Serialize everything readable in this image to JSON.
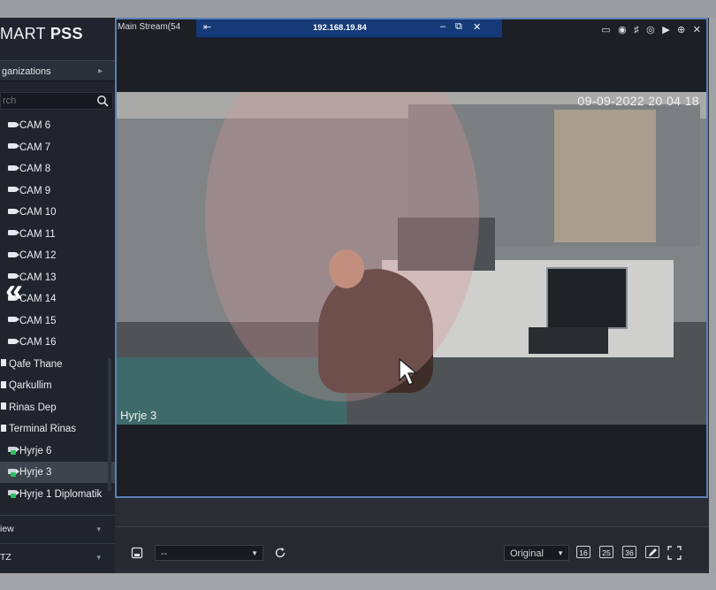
{
  "app": {
    "brand_light": "MART",
    "brand_bold": "PSS"
  },
  "sidebar": {
    "org_label": "ganizations",
    "search_placeholder": "rch",
    "items": [
      {
        "label": "CAM 6",
        "type": "camera"
      },
      {
        "label": "CAM 7",
        "type": "camera"
      },
      {
        "label": "CAM 8",
        "type": "camera"
      },
      {
        "label": "CAM 9",
        "type": "camera"
      },
      {
        "label": "CAM 10",
        "type": "camera"
      },
      {
        "label": "CAM 11",
        "type": "camera"
      },
      {
        "label": "CAM 12",
        "type": "camera"
      },
      {
        "label": "CAM 13",
        "type": "camera"
      },
      {
        "label": "CAM 14",
        "type": "camera"
      },
      {
        "label": "CAM 15",
        "type": "camera"
      },
      {
        "label": "CAM 16",
        "type": "camera"
      },
      {
        "label": "Qafe Thane",
        "type": "device"
      },
      {
        "label": "Qarkullim",
        "type": "device"
      },
      {
        "label": "Rinas Dep",
        "type": "device"
      },
      {
        "label": "Terminal Rinas",
        "type": "device"
      },
      {
        "label": "Hyrje 6",
        "type": "camera-online"
      },
      {
        "label": "Hyrje 3",
        "type": "camera-online",
        "selected": true
      },
      {
        "label": "Hyrje 1 Diplomatik",
        "type": "camera-online"
      }
    ],
    "bottom": [
      {
        "label": "iew"
      },
      {
        "label": "TZ"
      }
    ]
  },
  "video": {
    "stream_label": "Main Stream(54",
    "remote_ip": "192.168.19.84",
    "timestamp": "09-09-2022 20 04 18",
    "camera_name": "Hyrje 3"
  },
  "toolbar": {
    "layout_select": "--",
    "scale_select": "Original",
    "split_buttons": [
      "16",
      "25",
      "36"
    ]
  },
  "colors": {
    "sidebar_bg": "#20252d",
    "accent": "#5b7fb8",
    "remote_tab": "#163a78",
    "online": "#29c35a"
  }
}
